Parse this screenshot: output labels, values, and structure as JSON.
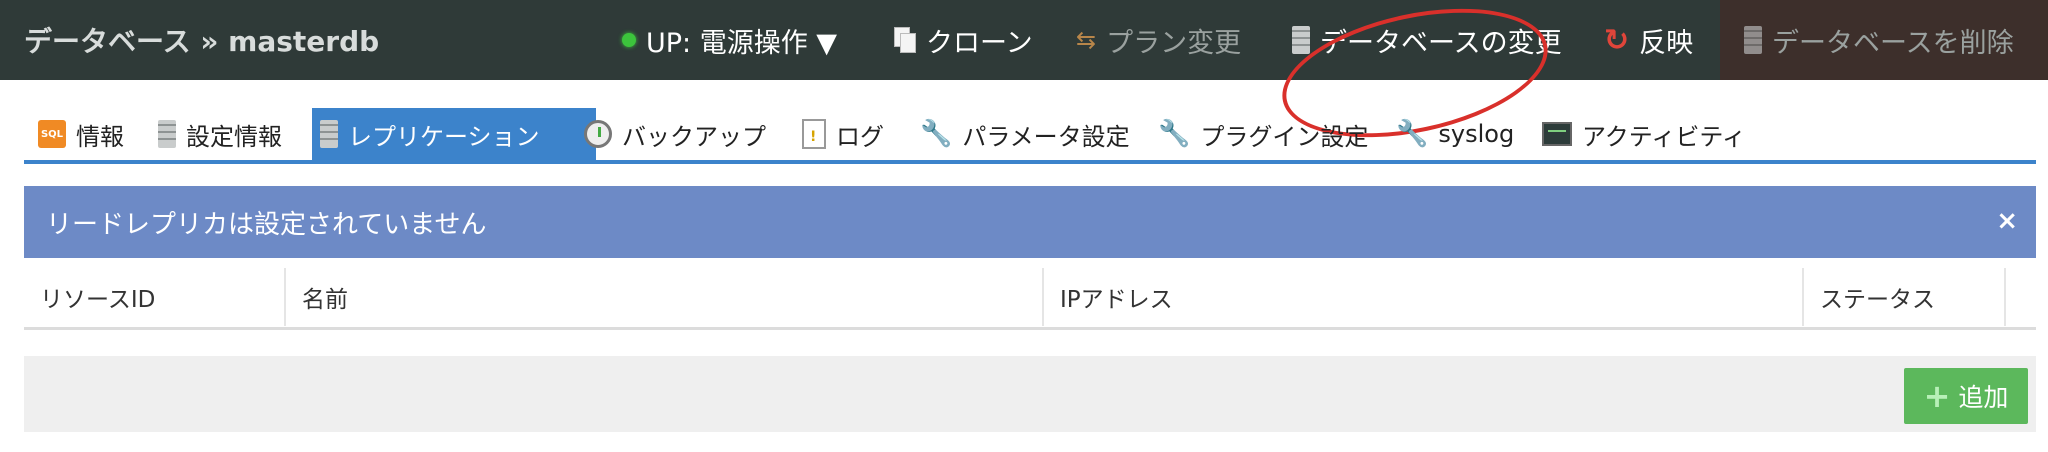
{
  "header": {
    "breadcrumb": "データベース » masterdb",
    "power_label": "UP: 電源操作 ▼",
    "clone_label": "クローン",
    "plan_change_label": "プラン変更",
    "db_change_label": "データベースの変更",
    "apply_label": "反映",
    "delete_label": "データベースを削除"
  },
  "tabs": [
    {
      "label": "情報"
    },
    {
      "label": "設定情報"
    },
    {
      "label": "レプリケーション",
      "active": true
    },
    {
      "label": "バックアップ"
    },
    {
      "label": "ログ"
    },
    {
      "label": "パラメータ設定"
    },
    {
      "label": "プラグイン設定"
    },
    {
      "label": "syslog"
    },
    {
      "label": "アクティビティ"
    }
  ],
  "alert": {
    "message": "リードレプリカは設定されていません",
    "close": "×"
  },
  "table": {
    "columns": [
      "リソースID",
      "名前",
      "IPアドレス",
      "ステータス"
    ],
    "rows": []
  },
  "footer": {
    "add_label": "追加"
  },
  "colors": {
    "topbar": "#2f3a38",
    "tab_active": "#3c83cb",
    "alert": "#6d8ac6",
    "add_button": "#5cb85c",
    "annotation_circle": "#d9302b"
  }
}
